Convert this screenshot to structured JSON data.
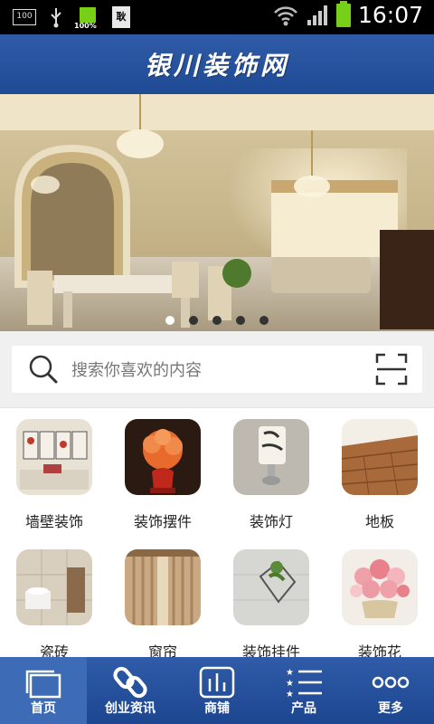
{
  "status_bar": {
    "sim_label": "100",
    "battery_small_label": "100%",
    "doc_label": "耿",
    "time": "16:07"
  },
  "header": {
    "title": "银川装饰网"
  },
  "banner": {
    "slides": 5,
    "active_slide": 0
  },
  "search": {
    "placeholder": "搜索你喜欢的内容"
  },
  "categories": [
    {
      "label": "墙壁装饰",
      "icon": "wall-decoration-image"
    },
    {
      "label": "装饰摆件",
      "icon": "ornament-image"
    },
    {
      "label": "装饰灯",
      "icon": "decorative-lamp-image"
    },
    {
      "label": "地板",
      "icon": "floor-image"
    },
    {
      "label": "瓷砖",
      "icon": "tile-image"
    },
    {
      "label": "窗帘",
      "icon": "curtain-image"
    },
    {
      "label": "装饰挂件",
      "icon": "wall-pendant-image"
    },
    {
      "label": "装饰花",
      "icon": "decorative-flower-image"
    }
  ],
  "tabs": [
    {
      "label": "首页",
      "icon": "home-icon",
      "active": true
    },
    {
      "label": "创业资讯",
      "icon": "link-icon",
      "active": false
    },
    {
      "label": "商铺",
      "icon": "chart-icon",
      "active": false
    },
    {
      "label": "产品",
      "icon": "list-icon",
      "active": false
    },
    {
      "label": "更多",
      "icon": "more-icon",
      "active": false
    }
  ],
  "colors": {
    "header": "#2a55a0",
    "tabbar": "#2a55a0",
    "tab_active": "#3e6bb5"
  }
}
